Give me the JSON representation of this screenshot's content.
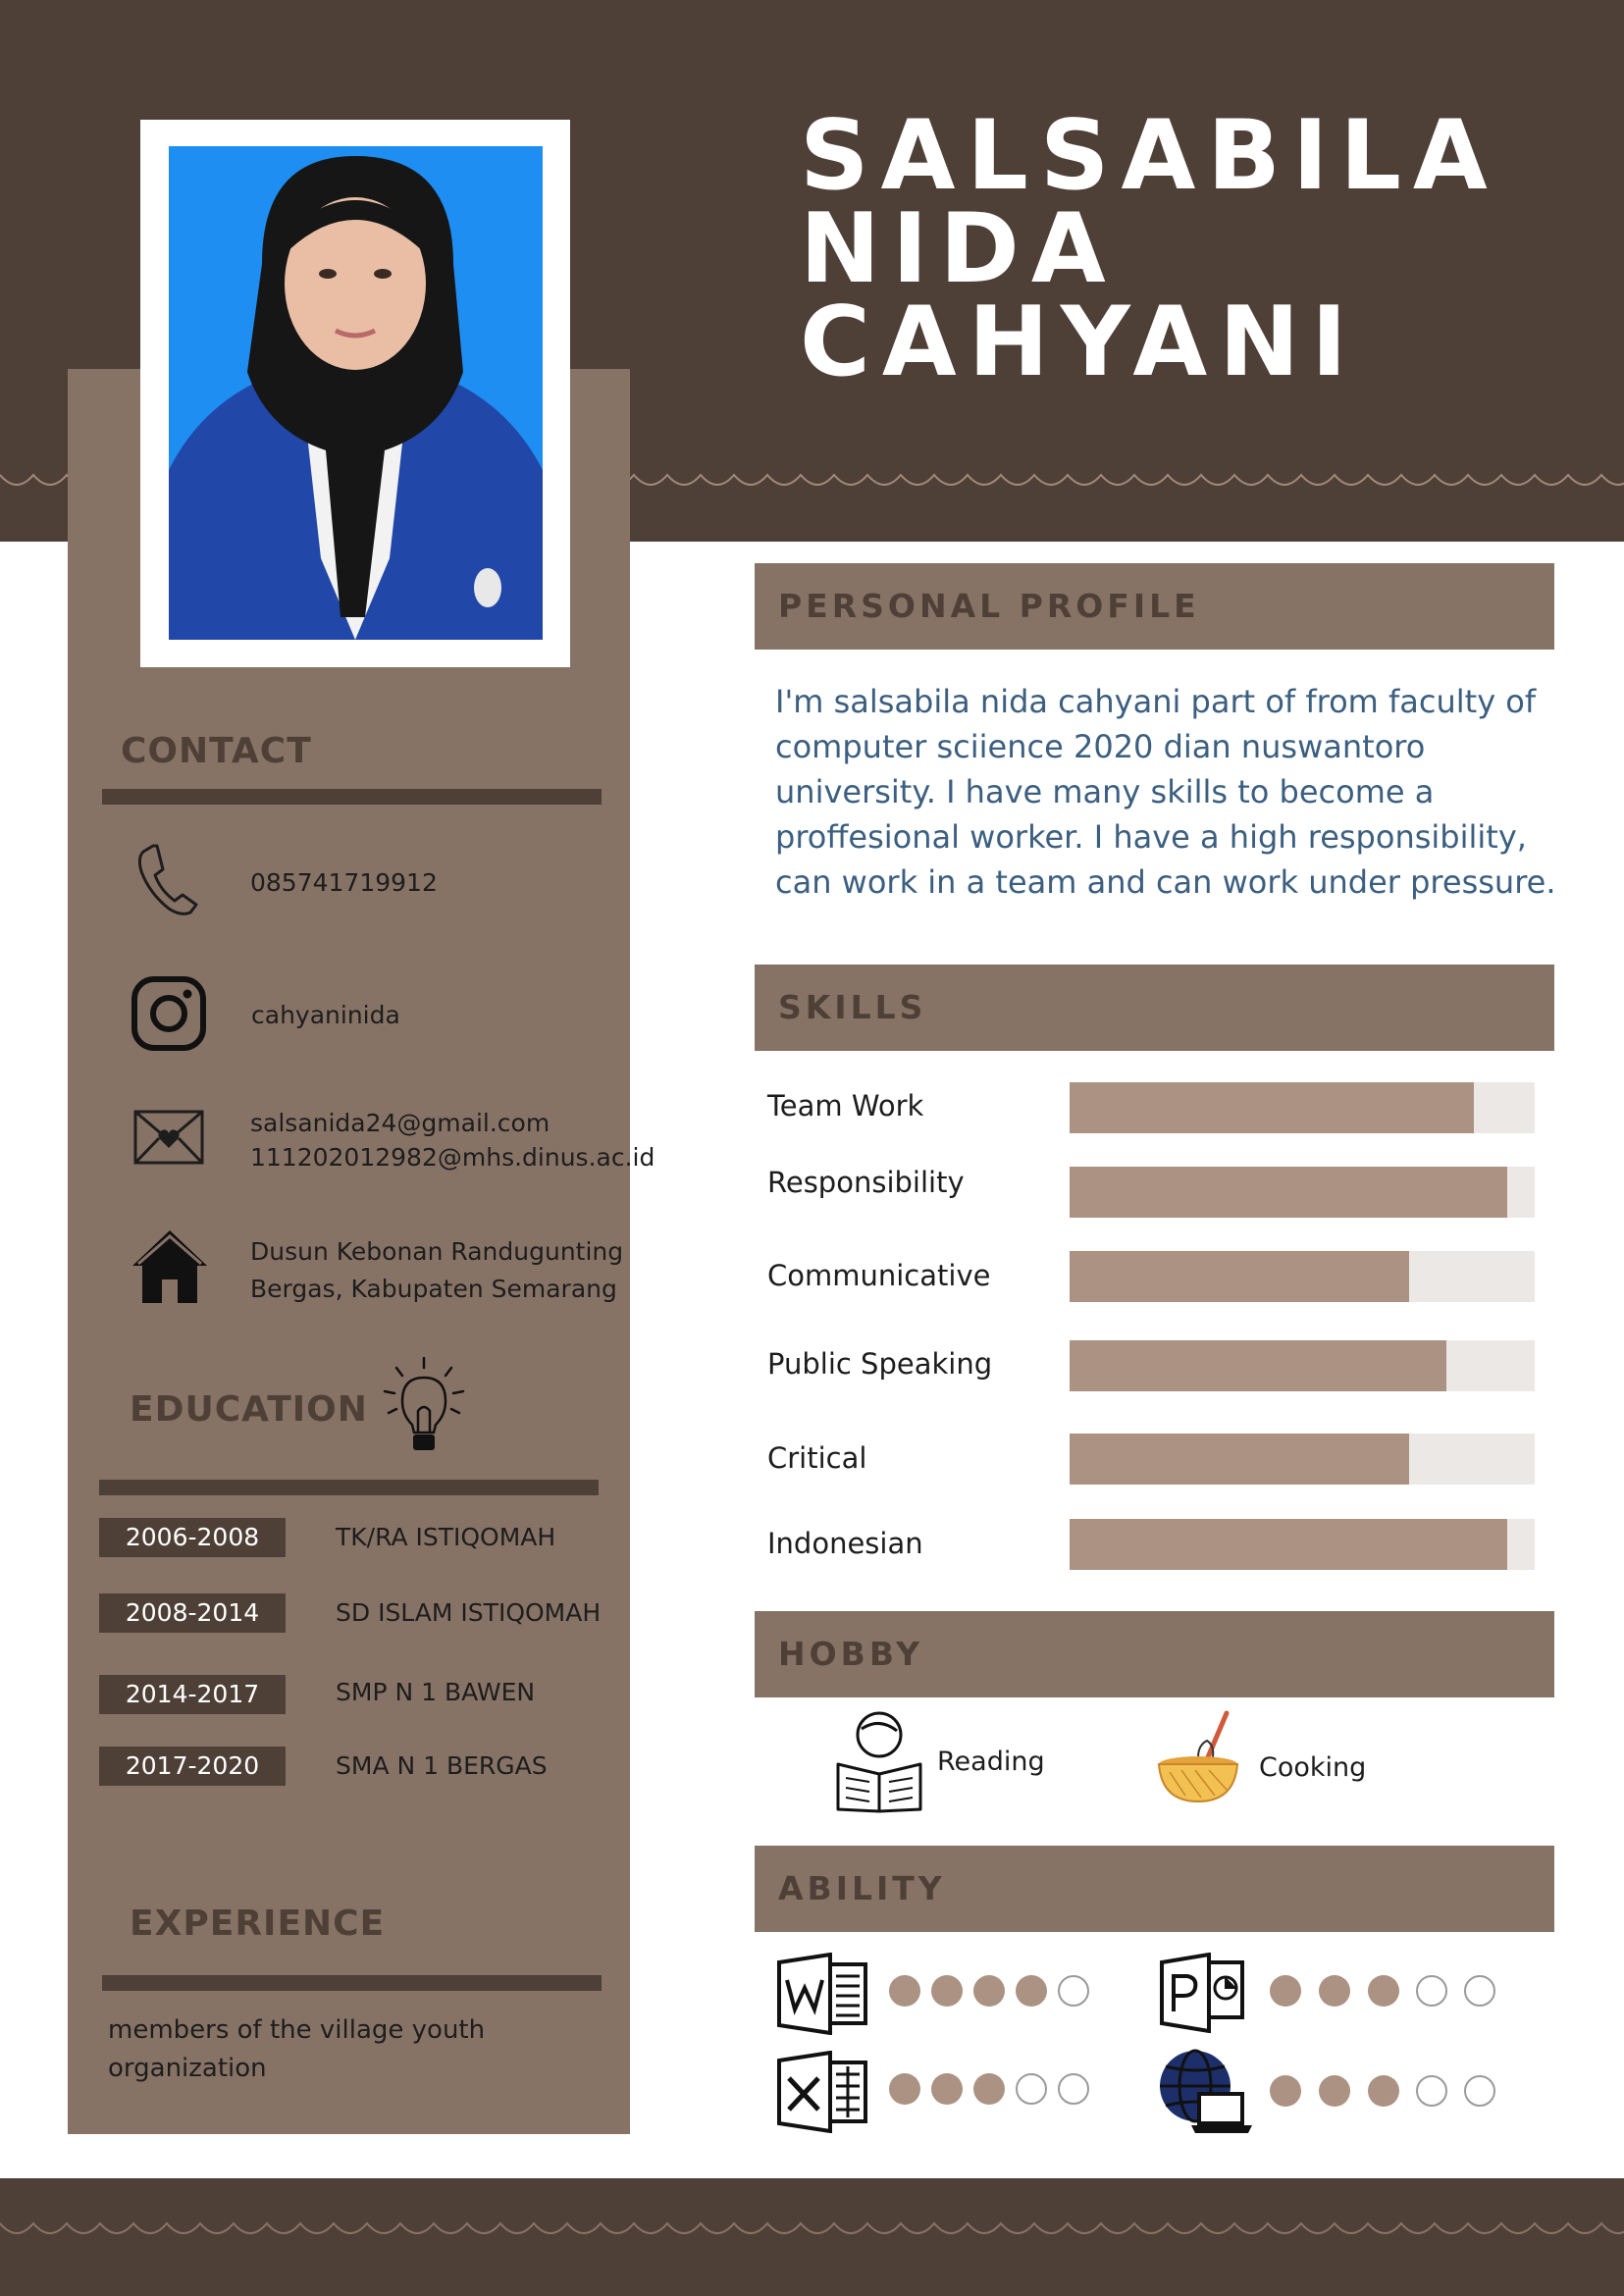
{
  "header": {
    "name_lines": [
      "SALSABILA",
      "NIDA",
      "CAHYANI"
    ]
  },
  "colors": {
    "dark_brown": "#4f4037",
    "mid_brown": "#877366",
    "bar_fill": "#ab9282",
    "bar_track": "#ece8e6",
    "profile_text": "#3c5f80",
    "photo_background": "#1e8ef2"
  },
  "contact": {
    "heading": "CONTACT",
    "phone": "085741719912",
    "instagram": "cahyaninida",
    "email_1": "salsanida24@gmail.com",
    "email_2": "111202012982@mhs.dinus.ac.id",
    "address_1": "Dusun Kebonan Randugunting",
    "address_2": "Bergas, Kabupaten Semarang",
    "icons": [
      "phone-icon",
      "instagram-icon",
      "envelope-heart-icon",
      "house-icon"
    ]
  },
  "education": {
    "heading": "EDUCATION",
    "items": [
      {
        "years": "2006-2008",
        "school": "TK/RA ISTIQOMAH"
      },
      {
        "years": "2008-2014",
        "school": "SD ISLAM ISTIQOMAH"
      },
      {
        "years": "2014-2017",
        "school": "SMP N 1 BAWEN"
      },
      {
        "years": "2017-2020",
        "school": "SMA N 1 BERGAS"
      }
    ]
  },
  "experience": {
    "heading": "EXPERIENCE",
    "text": "members of the village youth organization"
  },
  "profile": {
    "heading": "PERSONAL PROFILE",
    "text": "I'm salsabila nida cahyani part of from faculty of computer sciience 2020 dian nuswantoro university. I have many skills to become a proffesional worker. I have a high responsibility, can work in a team and can work under pressure."
  },
  "skills": {
    "heading": "SKILLS",
    "items": [
      {
        "label": "Team Work",
        "level": 0.87
      },
      {
        "label": "Responsibility",
        "level": 0.94
      },
      {
        "label": "Communicative",
        "level": 0.73
      },
      {
        "label": "Public Speaking",
        "level": 0.81
      },
      {
        "label": "Critical",
        "level": 0.73
      },
      {
        "label": "Indonesian",
        "level": 0.94
      }
    ]
  },
  "hobby": {
    "heading": "HOBBY",
    "items": [
      {
        "label": "Reading",
        "icon": "reading-book-icon"
      },
      {
        "label": "Cooking",
        "icon": "mixing-bowl-icon"
      }
    ]
  },
  "ability": {
    "heading": "ABILITY",
    "items": [
      {
        "app": "Word",
        "icon": "word-icon",
        "rating": 4,
        "max": 5
      },
      {
        "app": "PowerPoint",
        "icon": "powerpoint-icon",
        "rating": 3,
        "max": 5
      },
      {
        "app": "Excel",
        "icon": "excel-icon",
        "rating": 3,
        "max": 5
      },
      {
        "app": "Internet",
        "icon": "globe-laptop-icon",
        "rating": 3,
        "max": 5
      }
    ]
  }
}
